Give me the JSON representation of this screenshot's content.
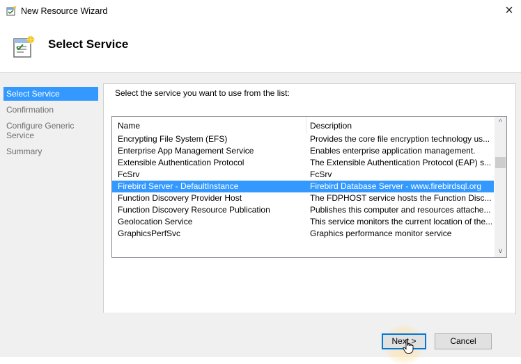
{
  "window": {
    "title": "New Resource Wizard",
    "close_glyph": "×"
  },
  "header": {
    "title": "Select Service",
    "icon": "wizard-page-icon"
  },
  "nav": {
    "items": [
      {
        "label": "Select Service",
        "active": true
      },
      {
        "label": "Confirmation",
        "active": false
      },
      {
        "label": "Configure Generic Service",
        "active": false
      },
      {
        "label": "Summary",
        "active": false
      }
    ]
  },
  "main": {
    "instruction": "Select the service you want to use from the list:",
    "columns": {
      "name": "Name",
      "description": "Description"
    },
    "rows": [
      {
        "name": "Encrypting File System (EFS)",
        "description": "Provides the core file encryption technology us..."
      },
      {
        "name": "Enterprise App Management Service",
        "description": "Enables enterprise application management."
      },
      {
        "name": "Extensible Authentication Protocol",
        "description": "The Extensible Authentication Protocol (EAP) s..."
      },
      {
        "name": "FcSrv",
        "description": "FcSrv"
      },
      {
        "name": "Firebird Server - DefaultInstance",
        "description": "Firebird Database Server - www.firebirdsql.org",
        "selected": true
      },
      {
        "name": "Function Discovery Provider Host",
        "description": "The FDPHOST service hosts the Function Disc..."
      },
      {
        "name": "Function Discovery Resource Publication",
        "description": "Publishes this computer and resources attache..."
      },
      {
        "name": "Geolocation Service",
        "description": "This service monitors the current location of the..."
      },
      {
        "name": "GraphicsPerfSvc",
        "description": "Graphics performance monitor service"
      }
    ],
    "scroll": {
      "up_glyph": "^",
      "down_glyph": "v",
      "position_fraction": 0.27,
      "visible_fraction": 0.08
    }
  },
  "buttons": {
    "next": "Next >",
    "cancel": "Cancel"
  },
  "colors": {
    "selection": "#3399ff",
    "default_button_border": "#0078d7"
  }
}
